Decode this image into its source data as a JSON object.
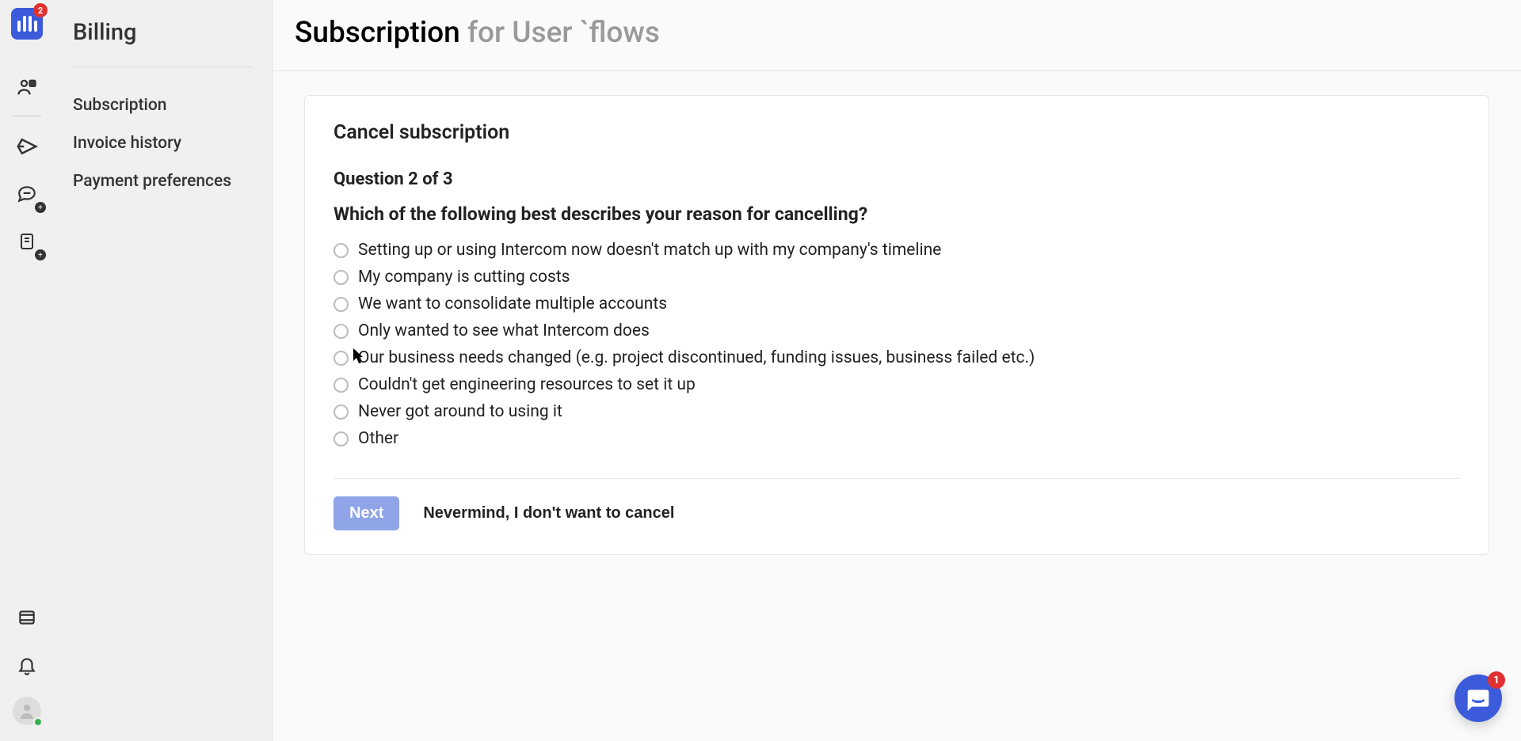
{
  "rail": {
    "logo_badge": "2"
  },
  "sidebar": {
    "title": "Billing",
    "items": [
      {
        "label": "Subscription"
      },
      {
        "label": "Invoice history"
      },
      {
        "label": "Payment preferences"
      }
    ]
  },
  "header": {
    "title_bold": "Subscription",
    "title_rest": " for User `flows"
  },
  "card": {
    "title": "Cancel subscription",
    "question_label": "Question 2 of 3",
    "question_text": "Which of the following best describes your reason for cancelling?",
    "options": [
      "Setting up or using Intercom now doesn't match up with my company's timeline",
      "My company is cutting costs",
      "We want to consolidate multiple accounts",
      "Only wanted to see what Intercom does",
      "Our business needs changed (e.g. project discontinued, funding issues, business failed etc.)",
      "Couldn't get engineering resources to set it up",
      "Never got around to using it",
      "Other"
    ],
    "next_label": "Next",
    "cancel_label": "Nevermind, I don't want to cancel"
  },
  "chat": {
    "badge": "1"
  }
}
